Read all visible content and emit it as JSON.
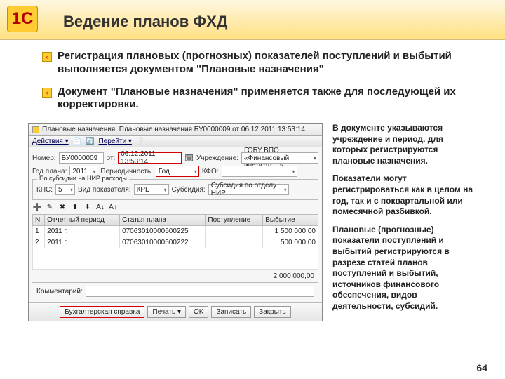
{
  "page_number": "64",
  "title": "Ведение планов ФХД",
  "bullets": [
    "Регистрация плановых (прогнозных) показателей поступлений и выбытий выполняется документом \"Плановые назначения\"",
    "Документ \"Плановые назначения\" применяется также для последующей их корректировки."
  ],
  "side": {
    "p1": "В документе указываются учреждение и период, для которых регистрируются плановые назначения.",
    "p2": "Показатели могут регистрироваться как в целом на год, так и с поквартальной или помесячной разбивкой.",
    "p3": "Плановые (прогнозные) показатели поступлений и выбытий регистрируются в разрезе статей планов поступлений и выбытий, источников финансового обеспечения, видов деятельности, субсидий."
  },
  "win": {
    "title": "Плановые назначения: Плановые назначения БУ0000009 от 06.12.2011 13:53:14",
    "actions": "Действия ▾",
    "go": "Перейти ▾",
    "labels": {
      "number": "Номер:",
      "number_val": "БУ0000009",
      "date_from": "от:",
      "date_val": "06.12.2011 13:53:14",
      "org": "Учреждение:",
      "org_val": "ГОБУ ВПО «Финансовый институт…»",
      "year": "Год плана:",
      "year_val": "2011",
      "period": "Периодичность:",
      "period_val": "Год",
      "kfo": "КФО:",
      "subsidy_title": "По субсидии на НИР расходы",
      "kps": "КПС:",
      "kps_val": "5",
      "indicator": "Вид показателя:",
      "indicator_val": "КРБ",
      "subsidy": "Субсидия:",
      "subsidy_val": "Субсидия по отделу НИР",
      "comment": "Комментарий:"
    },
    "th": {
      "n": "N",
      "period": "Отчетный период",
      "art": "Статья плана",
      "inc": "Поступление",
      "out": "Выбытие"
    },
    "rows": [
      {
        "n": "1",
        "period": "2011 г.",
        "code": "07063010000500225",
        "out": "1 500 000,00"
      },
      {
        "n": "2",
        "period": "2011 г.",
        "code": "07063010000500222",
        "out": "500 000,00"
      }
    ],
    "total": "2 000 000,00",
    "buttons": {
      "ref": "Бухгалтерская справка",
      "print": "Печать ▾",
      "ok": "OK",
      "save": "Записать",
      "close": "Закрыть"
    }
  }
}
